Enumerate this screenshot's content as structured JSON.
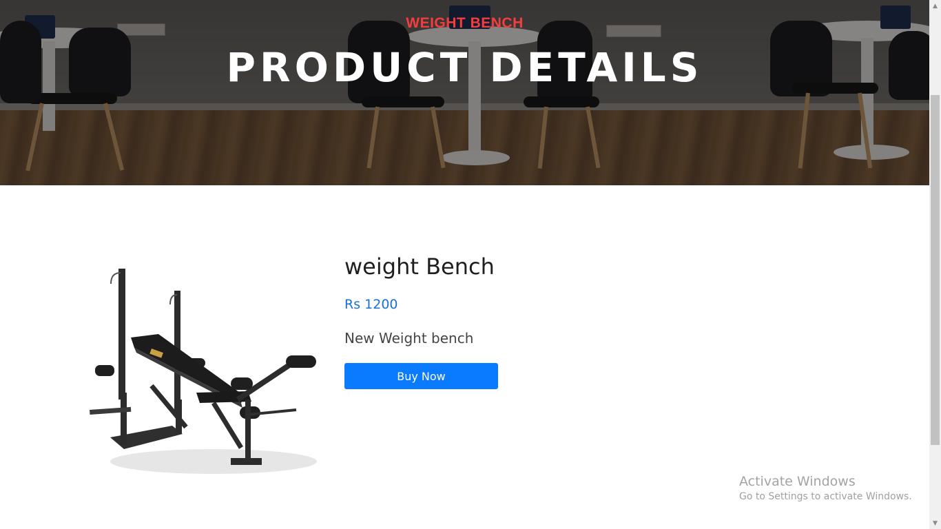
{
  "hero": {
    "subtitle": "WEIGHT BENCH",
    "title": "PRODUCT DETAILS"
  },
  "product": {
    "name": "weight Bench",
    "price": "Rs 1200",
    "description": "New Weight bench",
    "buy_label": "Buy Now",
    "image_icon": "weight-bench-image"
  },
  "watermark": {
    "title": "Activate Windows",
    "subtitle": "Go to Settings to activate Windows."
  },
  "colors": {
    "accent_red": "#f53d3d",
    "price_blue": "#1a6fd6",
    "button_blue": "#0a7bff"
  }
}
